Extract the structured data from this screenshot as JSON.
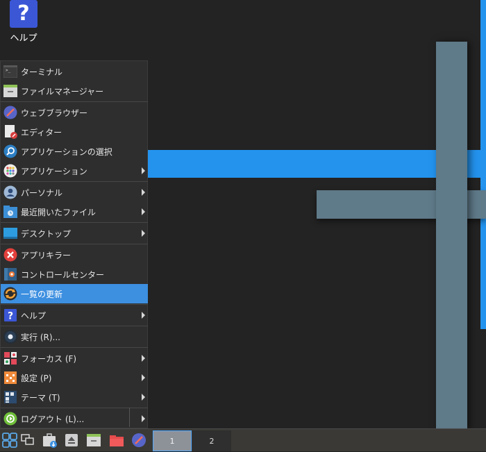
{
  "desktop": {
    "help_icon_label": "ヘルプ",
    "help_glyph": "?"
  },
  "menu": {
    "items": [
      {
        "label": "ターミナル",
        "icon": "terminal-icon"
      },
      {
        "label": "ファイルマネージャー",
        "icon": "file-manager-icon"
      },
      {
        "label": "ウェブブラウザー",
        "icon": "web-browser-icon"
      },
      {
        "label": "エディター",
        "icon": "editor-icon"
      },
      {
        "label": "アプリケーションの選択",
        "icon": "app-finder-icon"
      },
      {
        "label": "アプリケーション",
        "icon": "applications-icon",
        "submenu": true
      },
      {
        "label": "パーソナル",
        "icon": "personal-icon",
        "submenu": true
      },
      {
        "label": "最近開いたファイル",
        "icon": "recent-files-icon",
        "submenu": true
      },
      {
        "label": "デスクトップ",
        "icon": "desktop-icon",
        "submenu": true
      },
      {
        "label": "アプリキラー",
        "icon": "app-killer-icon"
      },
      {
        "label": "コントロールセンター",
        "icon": "control-center-icon"
      },
      {
        "label": "一覧の更新",
        "icon": "refresh-icon",
        "active": true
      },
      {
        "label": "ヘルプ",
        "icon": "help-icon",
        "submenu": true
      },
      {
        "label": "実行 (R)...",
        "icon": "run-icon"
      },
      {
        "label": "フォーカス (F)",
        "icon": "focus-icon",
        "submenu": true
      },
      {
        "label": "設定 (P)",
        "icon": "settings-icon",
        "submenu": true
      },
      {
        "label": "テーマ (T)",
        "icon": "theme-icon",
        "submenu": true
      },
      {
        "label": "ログアウト (L)...",
        "icon": "logout-icon",
        "submenu": true
      }
    ]
  },
  "taskbar": {
    "workspaces": [
      "1",
      "2"
    ],
    "current_workspace": "1"
  },
  "colors": {
    "accent": "#3d8fe0",
    "desktop_blue": "#2393ee",
    "desktop_grey": "#5f7a89"
  }
}
